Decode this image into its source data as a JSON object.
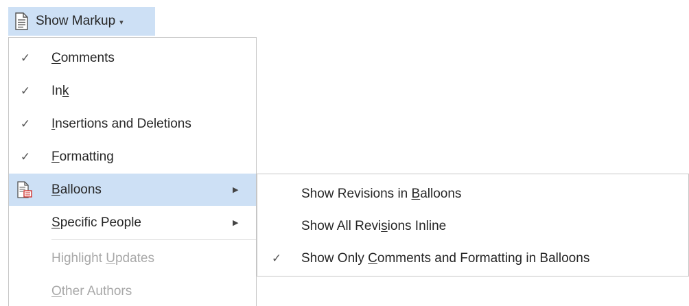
{
  "ribbon": {
    "button_label": "Show Markup",
    "button_icon": "document-icon",
    "caret": "▾"
  },
  "menu": {
    "items": [
      {
        "pre": "",
        "u": "C",
        "post": "omments",
        "checked": true,
        "check": "✓",
        "enabled": true
      },
      {
        "pre": "In",
        "u": "k",
        "post": "",
        "checked": true,
        "check": "✓",
        "enabled": true
      },
      {
        "pre": "",
        "u": "I",
        "post": "nsertions and Deletions",
        "checked": true,
        "check": "✓",
        "enabled": true
      },
      {
        "pre": "",
        "u": "F",
        "post": "ormatting",
        "checked": true,
        "check": "✓",
        "enabled": true
      },
      {
        "pre": "",
        "u": "B",
        "post": "alloons",
        "icon": "balloons-icon",
        "submenu": true,
        "highlighted": true,
        "arrow": "▶",
        "enabled": true
      },
      {
        "pre": "",
        "u": "S",
        "post": "pecific People",
        "submenu": true,
        "arrow": "▶",
        "enabled": true
      },
      {
        "pre": "Highlight ",
        "u": "U",
        "post": "pdates",
        "enabled": false
      },
      {
        "pre": "",
        "u": "O",
        "post": "ther Authors",
        "enabled": false
      }
    ]
  },
  "submenu": {
    "items": [
      {
        "pre": "Show Revisions in ",
        "u": "B",
        "post": "alloons",
        "checked": false
      },
      {
        "pre": "Show All Revi",
        "u": "s",
        "post": "ions Inline",
        "checked": false
      },
      {
        "pre": "Show Only ",
        "u": "C",
        "post": "omments and Formatting in Balloons",
        "checked": true,
        "check": "✓"
      }
    ]
  },
  "colors": {
    "highlight": "#cde0f5",
    "disabled_text": "#a8a8a8",
    "text": "#262626",
    "border": "#c6c6c6"
  }
}
